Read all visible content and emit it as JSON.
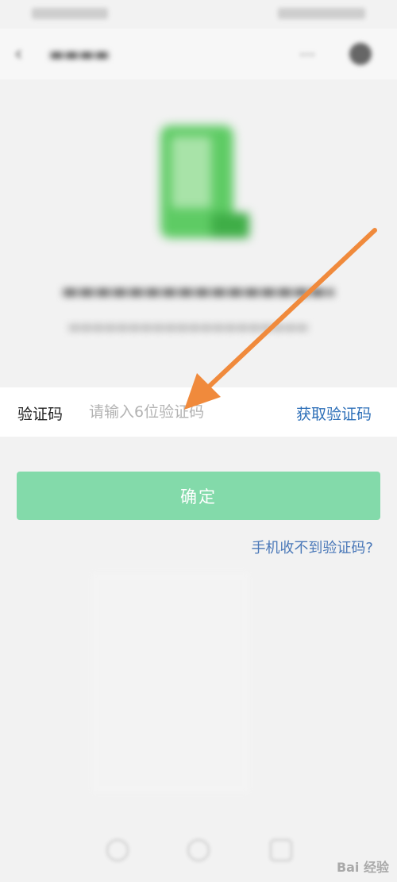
{
  "nav": {
    "back_icon": "back-arrow-icon",
    "more_icon": "more-icon"
  },
  "verification": {
    "label": "验证码",
    "placeholder": "请输入6位验证码",
    "value": "",
    "get_code_label": "获取验证码"
  },
  "confirm": {
    "label": "确定"
  },
  "help_link": "手机收不到验证码?",
  "watermark": {
    "text": "Bai 经验"
  },
  "colors": {
    "confirm_button": "#83daaa",
    "link": "#2d6fb8",
    "annotation_arrow": "#f08a3c"
  }
}
